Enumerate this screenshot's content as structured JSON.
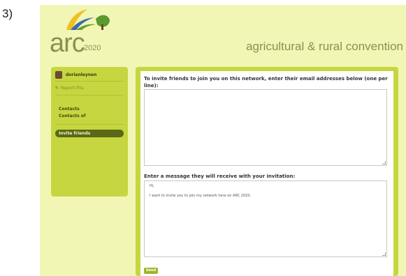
{
  "step_label": "3)",
  "header": {
    "logo_text": "arc",
    "logo_year": "2020",
    "tagline": "agricultural & rural convention"
  },
  "sidebar": {
    "username": "dorianleynen",
    "report_link": "Report this",
    "links": [
      "Contacts",
      "Contacts of"
    ],
    "active_item": "Invite friends"
  },
  "form": {
    "invite_instructions": "To invite friends to join you on this network, enter their email addresses below (one per line):",
    "emails_value": "",
    "message_label": "Enter a message they will receive with your invitation:",
    "message_lines": [
      "Hi,",
      "",
      "I want to invite you to join my network here on ARC 2020."
    ],
    "send_label": "Send"
  },
  "colors": {
    "page_background": "#f2f6b4",
    "panel_green": "#c6d640",
    "active_pill": "#5a6818",
    "send_button": "#9fb42c"
  }
}
